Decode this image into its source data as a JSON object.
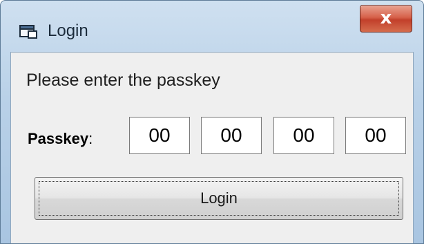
{
  "window": {
    "title": "Login",
    "close_label": "x"
  },
  "form": {
    "prompt": "Please enter the passkey",
    "passkey_label": "Passkey",
    "passkey_colon": ":",
    "fields": [
      "00",
      "00",
      "00",
      "00"
    ]
  },
  "buttons": {
    "login_label": "Login"
  },
  "icons": {
    "title_icon": "app-window-icon",
    "close_icon": "close-icon"
  }
}
